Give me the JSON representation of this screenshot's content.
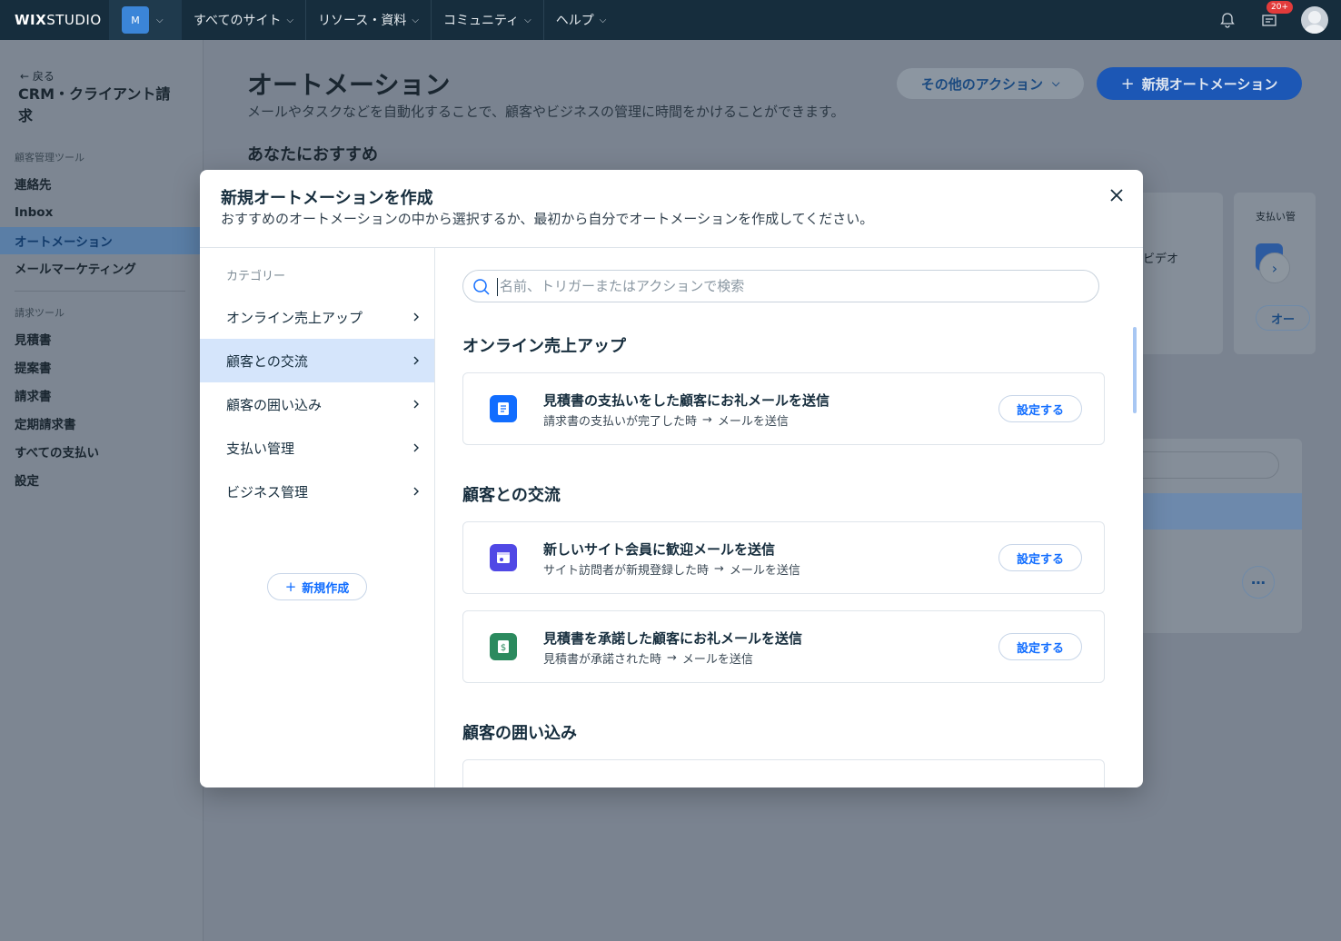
{
  "topbar": {
    "logo_brand": "WIX",
    "logo_product": "STUDIO",
    "site_initial": "M",
    "nav": [
      "すべてのサイト",
      "リソース・資料",
      "コミュニティ",
      "ヘルプ"
    ],
    "notifications_badge": "20+"
  },
  "sidebar": {
    "back_label": "戻る",
    "app_title": "CRM・クライアント請求",
    "section1_label": "顧客管理ツール",
    "section1_items": [
      "連絡先",
      "Inbox",
      "オートメーション",
      "メールマーケティング"
    ],
    "section2_label": "請求ツール",
    "section2_items": [
      "見積書",
      "提案書",
      "請求書",
      "定期請求書",
      "すべての支払い",
      "設定"
    ]
  },
  "page": {
    "title": "オートメーション",
    "subtitle": "メールやタスクなどを自動化することで、顧客やビジネスの管理に時間をかけることができます。",
    "other_actions": "その他のアクション",
    "new_automation": "新規オートメーション",
    "recommended_title": "あなたにおすすめ",
    "bg_video_text": "ビデオ",
    "bg_payment_text": "支払い管",
    "bg_button_text": "オー"
  },
  "modal": {
    "title": "新規オートメーションを作成",
    "subtitle": "おすすめのオートメーションの中から選択するか、最初から自分でオートメーションを作成してください。",
    "category_label": "カテゴリー",
    "categories": [
      "オンライン売上アップ",
      "顧客との交流",
      "顧客の囲い込み",
      "支払い管理",
      "ビジネス管理"
    ],
    "active_category_index": 1,
    "new_create_label": "新規作成",
    "search_placeholder": "名前、トリガーまたはアクションで検索",
    "search_value": "",
    "setup_label": "設定する",
    "sections": [
      {
        "title": "オンライン売上アップ",
        "items": [
          {
            "title": "見積書の支払いをした顧客にお礼メールを送信",
            "trigger": "請求書の支払いが完了した時",
            "action": "メールを送信",
            "icon": "invoice-icon",
            "icon_color": "#116dff"
          }
        ]
      },
      {
        "title": "顧客との交流",
        "items": [
          {
            "title": "新しいサイト会員に歓迎メールを送信",
            "trigger": "サイト訪問者が新規登録した時",
            "action": "メールを送信",
            "icon": "member-icon",
            "icon_color": "#5048e5"
          },
          {
            "title": "見積書を承諾した顧客にお礼メールを送信",
            "trigger": "見積書が承諾された時",
            "action": "メールを送信",
            "icon": "quote-dollar-icon",
            "icon_color": "#2b8a5e"
          }
        ]
      },
      {
        "title": "顧客の囲い込み",
        "items": []
      }
    ]
  },
  "colors": {
    "accent": "#116dff",
    "topbar_bg": "#162d3d",
    "active_category_bg": "#d5e5fb"
  }
}
